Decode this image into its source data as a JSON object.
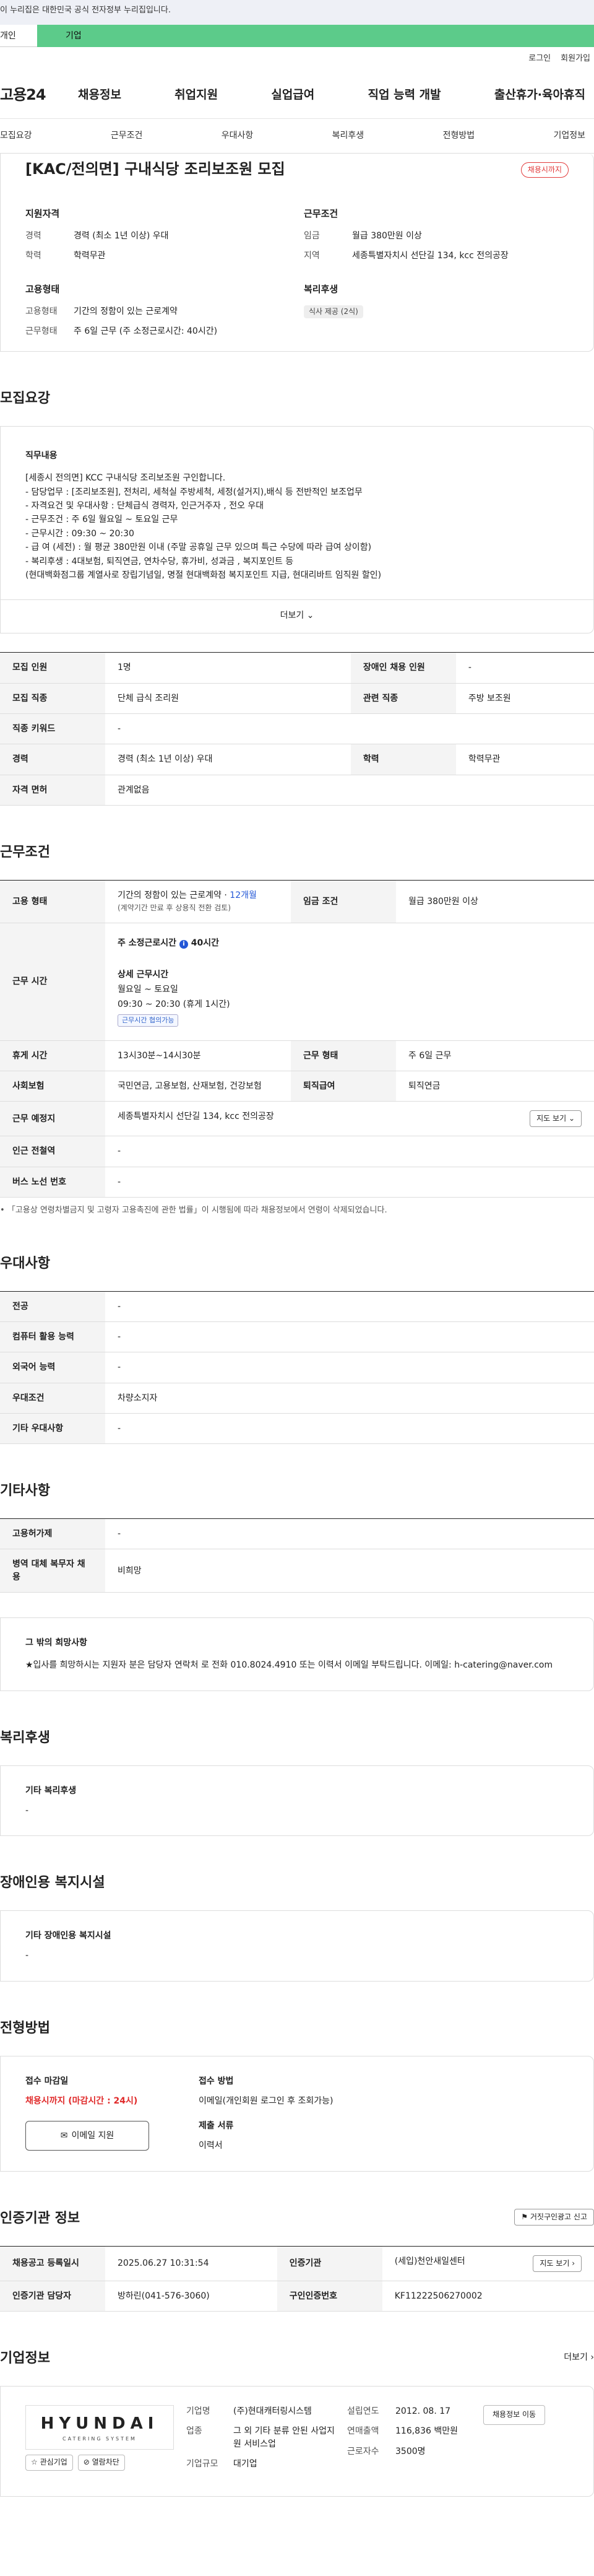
{
  "gov_notice": "이 누리집은 대한민국 공식 전자정부 누리집입니다.",
  "tabs": {
    "personal": "개인",
    "company": "기업"
  },
  "util": {
    "login": "로그인",
    "join": "회원가입"
  },
  "gnb": {
    "logo": "고용24",
    "menu": [
      "채용정보",
      "취업지원",
      "실업급여",
      "직업 능력 개발",
      "출산휴가·육아휴직"
    ]
  },
  "lnb": [
    "모집요강",
    "근무조건",
    "우대사항",
    "복리후생",
    "전형방법",
    "기업정보"
  ],
  "summary": {
    "title": "[KAC/전의면] 구내식당 조리보조원 모집",
    "status": "채용시까지",
    "qual_h": "지원자격",
    "career_k": "경력",
    "career_v": "경력 (최소 1년 이상) 우대",
    "edu_k": "학력",
    "edu_v": "학력무관",
    "emp_h": "고용형태",
    "emptype_k": "고용형태",
    "emptype_v": "기간의 정함이 있는 근로계약",
    "worktype_k": "근무형태",
    "worktype_v": "주 6일 근무 (주 소정근로시간: 40시간)",
    "cond_h": "근무조건",
    "wage_k": "임금",
    "wage_v": "월급 380만원 이상",
    "region_k": "지역",
    "region_v": "세종특별자치시 선단길 134, kcc 전의공장",
    "welfare_h": "복리후생",
    "welfare_tag": "식사 제공 (2식)"
  },
  "recruit": {
    "title": "모집요강",
    "desc_h": "직무내용",
    "lines": [
      "[세종시 전의면] KCC 구내식당 조리보조원 구인합니다.",
      "- 담당업무 : [조리보조원], 전처리, 세척실 주방세척, 세정(설거지),배식 등  전반적인 보조업무",
      "- 자격요건 및 우대사항 : 단체급식 경력자, 인근거주자 , 전오 우대",
      "- 근무조건 : 주 6일 월요일 ~ 토요일 근무",
      "- 근무시간 : 09:30 ~ 20:30",
      "- 급 여 (세전) : 월 평균 380만원 이내 (주말 공휴일 근무 있으며 특근 수당에 따라 급여 상이함)",
      "- 복리후생 : 4대보험, 퇴직연금, 연차수당, 휴가비, 성과금 , 복지포인트 등",
      "(현대백화점그룹 계열사로 장립기념일, 명절 현대백화점 복지포인트 지급, 현대리바트 임직원 할인)"
    ],
    "more": "더보기",
    "rows": [
      [
        "모집 인원",
        "1명",
        "장애인 채용 인원",
        "-"
      ],
      [
        "모집 직종",
        "단체 급식 조리원",
        "관련 직종",
        "주방 보조원"
      ],
      [
        "직종 키워드",
        "-",
        "",
        ""
      ],
      [
        "경력",
        "경력 (최소 1년 이상) 우대",
        "학력",
        "학력무관"
      ],
      [
        "자격 면허",
        "관계없음",
        "",
        ""
      ]
    ]
  },
  "cond": {
    "title": "근무조건",
    "emptype_k": "고용 형태",
    "emptype_v": "기간의 정함이 있는 근로계약",
    "emptype_months": "12개월",
    "emptype_note": "(계약기간 만료 후 상용직 전환 검토)",
    "wage_k": "임금 조건",
    "wage_v": "월급 380만원 이상",
    "hours_k": "근무 시간",
    "weekly_h": "주 소정근로시간",
    "weekly_v": "40시간",
    "detail_h": "상세 근무시간",
    "days": "월요일 ~ 토요일",
    "time": "09:30 ~ 20:30  (휴게 1시간)",
    "time_badge": "근무시간 협의가능",
    "break_k": "휴게 시간",
    "break_v": "13시30분~14시30분",
    "form_k": "근무 형태",
    "form_v": "주 6일 근무",
    "ins_k": "사회보험",
    "ins_v": "국민연금, 고용보험, 산재보험, 건강보험",
    "ret_k": "퇴직급여",
    "ret_v": "퇴직연금",
    "loc_k": "근무 예정지",
    "loc_v": "세종특별자치시 선단길 134, kcc 전의공장",
    "map_btn": "지도 보기",
    "sub_k": "인근 전철역",
    "sub_v": "-",
    "bus_k": "버스 노선 번호",
    "bus_v": "-",
    "footnote": "「고용상 연령차별금지 및 고령자 고용촉진에 관한 법률」이 시행됨에 따라 채용정보에서 연령이 삭제되었습니다."
  },
  "pref": {
    "title": "우대사항",
    "rows": [
      [
        "전공",
        "-"
      ],
      [
        "컴퓨터 활용 능력",
        "-"
      ],
      [
        "외국어 능력",
        "-"
      ],
      [
        "우대조건",
        "차량소지자"
      ],
      [
        "기타 우대사항",
        "-"
      ]
    ]
  },
  "etc": {
    "title": "기타사항",
    "rows": [
      [
        "고용허가제",
        "-"
      ],
      [
        "병역 대체 복무자 채용",
        "비희망"
      ]
    ],
    "other_h": "그 밖의 희망사항",
    "other_v": "★입사를 희망하시는 지원자 분은 담당자 연락처 로 전화 010.8024.4910 또는 이력서 이메일  부탁드립니다. 이메일: h-catering@naver.com"
  },
  "welfare": {
    "title": "복리후생",
    "h": "기타 복리후생",
    "v": "-"
  },
  "disab": {
    "title": "장애인용 복지시설",
    "h": "기타 장애인용 복지시설",
    "v": "-"
  },
  "select": {
    "title": "전형방법",
    "deadline_h": "접수 마감일",
    "deadline_v": "채용시까지 (마감시간 : 24시)",
    "method_h": "접수 방법",
    "method_v": "이메일(개인회원 로그인 후 조회가능)",
    "docs_h": "제출 서류",
    "docs_v": "이력서",
    "apply": "이메일 지원"
  },
  "cert": {
    "title": "인증기관 정보",
    "report_btn": "거짓구인광고 신고",
    "reg_k": "채용공고 등록일시",
    "reg_v": "2025.06.27 10:31:54",
    "org_k": "인증기관",
    "org_v": "(세입)천안새일센터",
    "map_btn": "지도 보기",
    "mgr_k": "인증기관 담당자",
    "mgr_v": "방하린(041-576-3060)",
    "no_k": "구인인증번호",
    "no_v": "KF11222506270002"
  },
  "company": {
    "title": "기업정보",
    "more": "더보기",
    "logo_word": "HYUNDAI",
    "logo_sub": "CATERING SYSTEM",
    "fav": "관심기업",
    "block": "열람차단",
    "name_k": "기업명",
    "name_v": "(주)현대캐터링시스템",
    "ind_k": "업종",
    "ind_v": "그 외 기타 분류 안된 사업지원 서비스업",
    "size_k": "기업규모",
    "size_v": "대기업",
    "est_k": "설립연도",
    "est_v": "2012. 08. 17",
    "sales_k": "연매출액",
    "sales_v": "116,836 백만원",
    "emp_k": "근로자수",
    "emp_v": "3500명",
    "jobs_btn": "채용정보 이동"
  }
}
